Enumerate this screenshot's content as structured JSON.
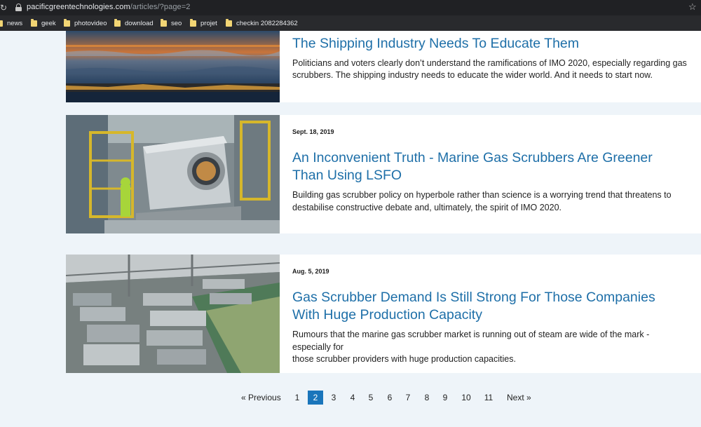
{
  "browser": {
    "url_host": "pacificgreentechnologies.com",
    "url_path": "/articles/?page=2",
    "bookmarks": [
      "news",
      "geek",
      "photovideo",
      "download",
      "seo",
      "projet",
      "checkin 2082284362"
    ]
  },
  "articles": [
    {
      "date": "",
      "title_line1": "The Shipping Industry Needs To Educate Them",
      "title_line2": "",
      "excerpt_line1": "Politicians and voters clearly don’t understand the ramifications of IMO 2020, especially regarding gas",
      "excerpt_line2": "scrubbers. The shipping industry needs to educate the wider world. And it needs to start now."
    },
    {
      "date": "Sept. 18, 2019",
      "title_line1": "An Inconvenient Truth - Marine Gas Scrubbers Are Greener",
      "title_line2": "Than Using LSFO",
      "excerpt_line1": "Building gas scrubber policy on hyperbole rather than science is a worrying trend that threatens to",
      "excerpt_line2": "destabilise constructive debate and, ultimately, the spirit of IMO 2020."
    },
    {
      "date": "Aug. 5, 2019",
      "title_line1": "Gas Scrubber Demand Is Still Strong For Those Companies",
      "title_line2": "With Huge Production Capacity",
      "excerpt_line1": "Rumours that the marine gas scrubber market is running out of steam are wide of the mark - especially for",
      "excerpt_line2": "those scrubber providers with huge production capacities."
    }
  ],
  "pagination": {
    "previous": "« Previous",
    "pages": [
      "1",
      "2",
      "3",
      "4",
      "5",
      "6",
      "7",
      "8",
      "9",
      "10",
      "11"
    ],
    "current": "2",
    "next": "Next »"
  }
}
